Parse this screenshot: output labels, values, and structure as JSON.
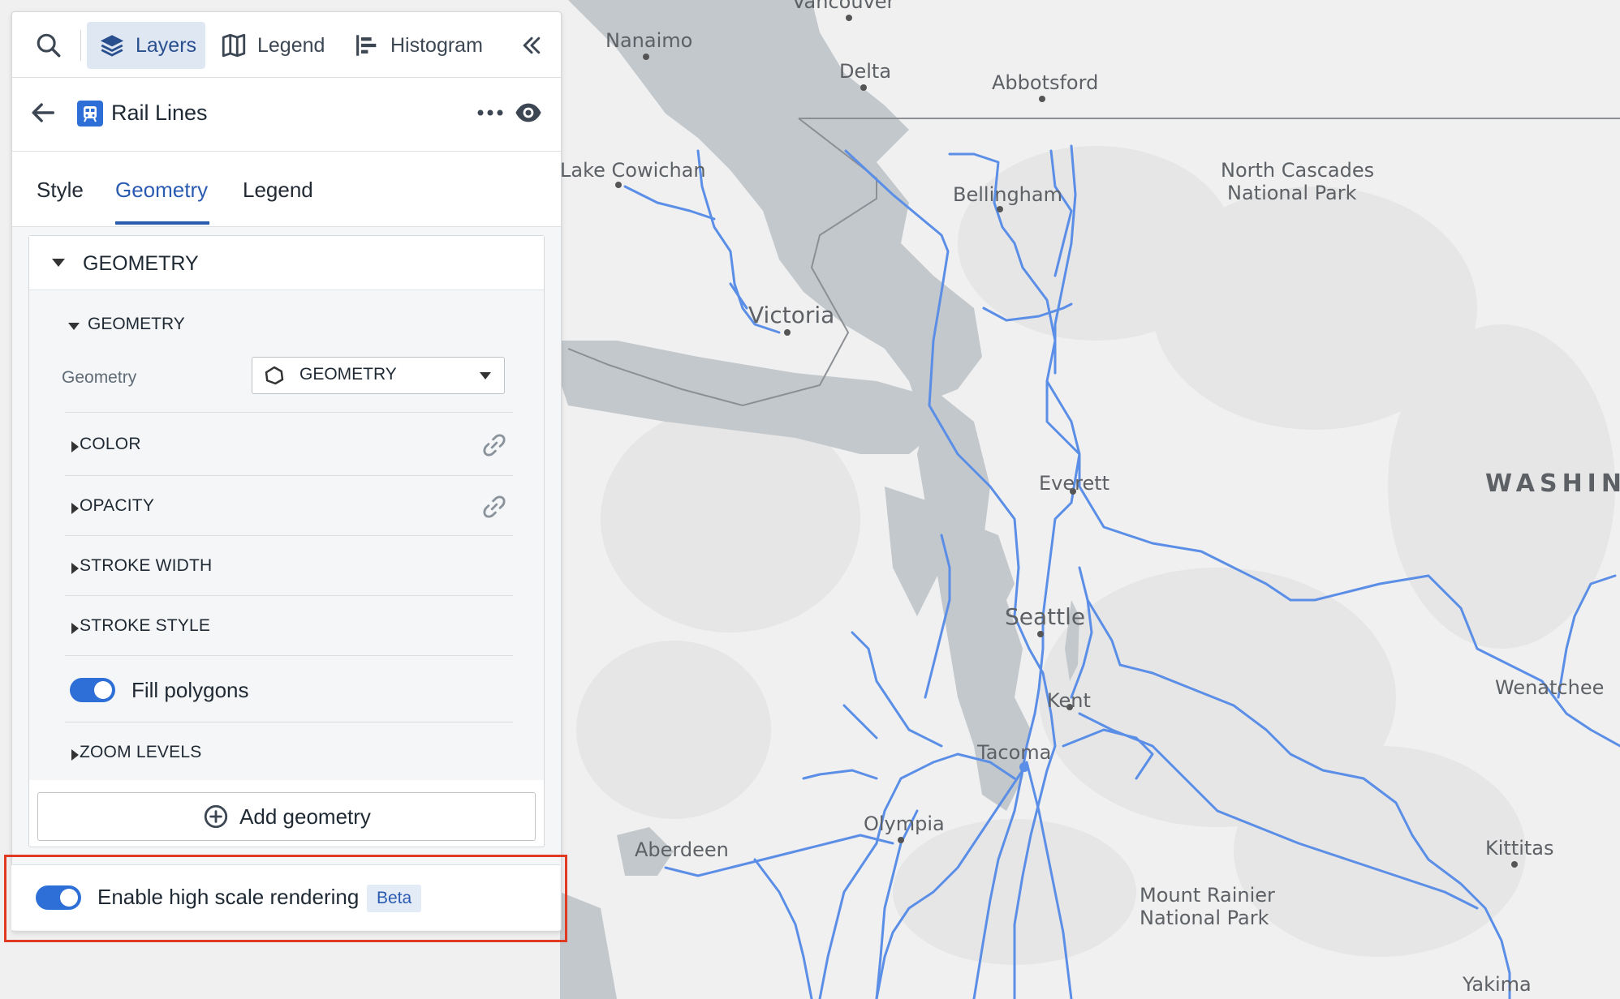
{
  "toolbar": {
    "tabs": [
      {
        "label": "Layers",
        "icon": "layers-icon",
        "active": true
      },
      {
        "label": "Legend",
        "icon": "map-legend-icon",
        "active": false
      },
      {
        "label": "Histogram",
        "icon": "histogram-icon",
        "active": false
      }
    ]
  },
  "layer": {
    "title": "Rail Lines",
    "icon": "train-icon",
    "icon_color": "#2d6fd6"
  },
  "tabs": [
    {
      "label": "Style",
      "active": false
    },
    {
      "label": "Geometry",
      "active": true
    },
    {
      "label": "Legend",
      "active": false
    }
  ],
  "geometry_panel": {
    "section_title": "GEOMETRY",
    "subsection_title": "GEOMETRY",
    "field_label": "Geometry",
    "field_value": "GEOMETRY",
    "rows": [
      {
        "label": "COLOR",
        "linked": true
      },
      {
        "label": "OPACITY",
        "linked": true
      },
      {
        "label": "STROKE WIDTH",
        "linked": false
      },
      {
        "label": "STROKE STYLE",
        "linked": false
      }
    ],
    "fill_toggle": {
      "label": "Fill polygons",
      "on": true
    },
    "zoom_row": {
      "label": "ZOOM LEVELS"
    },
    "add_button": "Add geometry"
  },
  "high_scale": {
    "label": "Enable high scale rendering",
    "badge": "Beta",
    "on": true
  },
  "colors": {
    "accent": "#2d6fd6",
    "highlight": "#e03a22",
    "rail": "#5b8ee6",
    "water": "#bfc5c9",
    "land": "#f0f0f0"
  },
  "map": {
    "labels": [
      {
        "text": "Vancouver"
      },
      {
        "text": "Nanaimo"
      },
      {
        "text": "Delta"
      },
      {
        "text": "Abbotsford"
      },
      {
        "text": "Lake Cowichan"
      },
      {
        "text": "Bellingham"
      },
      {
        "text": "North Cascades"
      },
      {
        "text": "National Park"
      },
      {
        "text": "Victoria"
      },
      {
        "text": "Everett"
      },
      {
        "text": "WASHIN"
      },
      {
        "text": "Seattle"
      },
      {
        "text": "Kent"
      },
      {
        "text": "Wenatchee"
      },
      {
        "text": "Tacoma"
      },
      {
        "text": "Olympia"
      },
      {
        "text": "Aberdeen"
      },
      {
        "text": "Kittitas"
      },
      {
        "text": "Mount Rainier"
      },
      {
        "text": "National Park"
      },
      {
        "text": "Yakima"
      }
    ]
  }
}
